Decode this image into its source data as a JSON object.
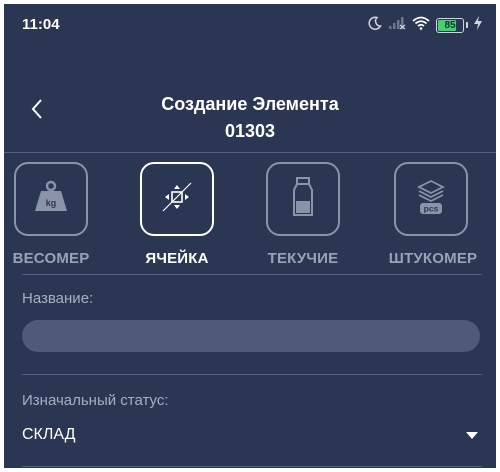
{
  "status_bar": {
    "time": "11:04",
    "battery": "85"
  },
  "header": {
    "title": "Создание Элемента",
    "code": "01303"
  },
  "tabs": [
    {
      "label": "ВЕСОМЕР",
      "icon": "weight-kg-icon",
      "active": false
    },
    {
      "label": "ЯЧЕЙКА",
      "icon": "cell-move-icon",
      "active": true
    },
    {
      "label": "ТЕКУЧИЕ",
      "icon": "bottle-icon",
      "active": false
    },
    {
      "label": "ШТУКОМЕР",
      "icon": "pcs-stack-icon",
      "active": false
    }
  ],
  "form": {
    "name_label": "Название:",
    "name_value": "",
    "status_label": "Изначальный статус:",
    "status_value": "СКЛАД"
  },
  "colors": {
    "background": "#2b3653",
    "input_bg": "#4f5a77",
    "inactive": "#8a93a8",
    "battery": "#43d36d"
  }
}
